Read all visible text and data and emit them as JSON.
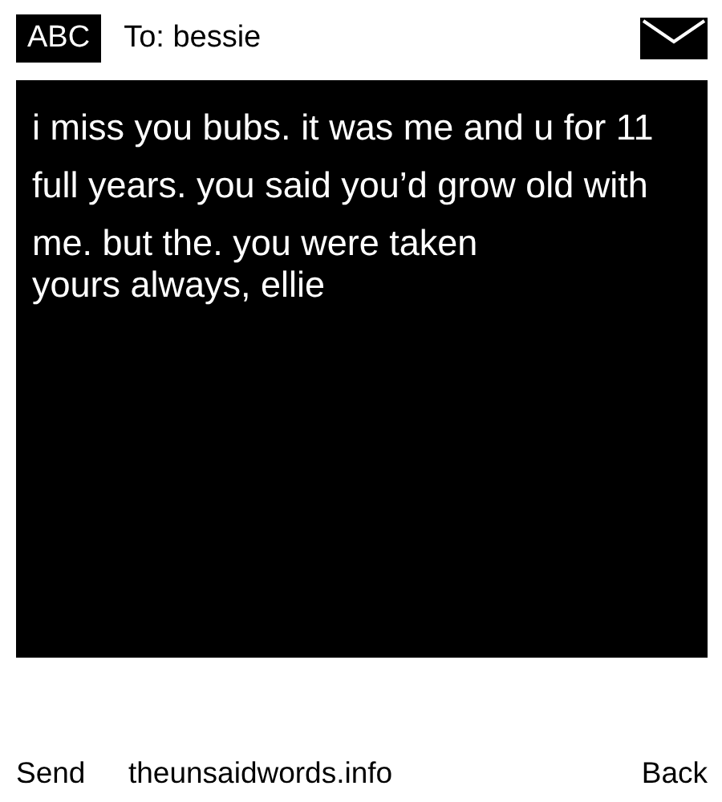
{
  "header": {
    "mode": "ABC",
    "recipient": "To: bessie"
  },
  "message": {
    "body": "i miss you bubs. it was me and u for 11 full years. you said you’d grow old with me. but the. you were taken",
    "signature": "yours always, ellie"
  },
  "footer": {
    "send": "Send",
    "site": "theunsaidwords.info",
    "back": "Back"
  }
}
